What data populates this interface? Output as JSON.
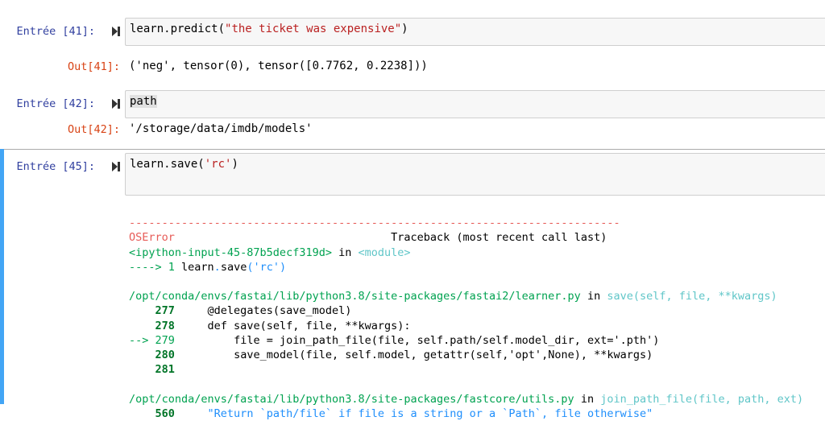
{
  "cells": [
    {
      "prompt": "Entrée [41]:",
      "code_plain": "learn.predict(",
      "code_string": "\"the ticket was expensive\"",
      "code_end": ")",
      "out_prompt": "Out[41]:",
      "output": "('neg', tensor(0), tensor([0.7762, 0.2238]))"
    },
    {
      "prompt": "Entrée [42]:",
      "code": "path",
      "out_prompt": "Out[42]:",
      "output": "'/storage/data/imdb/models'"
    },
    {
      "prompt": "Entrée [45]:",
      "code_plain": "learn.save(",
      "code_string": "'rc'",
      "code_end": ")"
    }
  ],
  "traceback": {
    "dashes": "---------------------------------------------------------------------------",
    "error_name": "OSError",
    "traceback_header": "Traceback (most recent call last)",
    "input_ref": "<ipython-input-45-87b5decf319d>",
    "in_word": " in ",
    "module": "<module>",
    "arrow_line_prefix": "----> 1 ",
    "arrow_line_obj": "learn",
    "arrow_line_dot": ".",
    "arrow_line_fn": "save",
    "arrow_line_p1": "(",
    "arrow_line_str": "'rc'",
    "arrow_line_p2": ")",
    "frame1": {
      "path": "/opt/conda/envs/fastai/lib/python3.8/site-packages/fastai2/learner.py",
      "func": "save(self, file, **kwargs)",
      "lines": [
        {
          "num": "277",
          "text": "@delegates(save_model)"
        },
        {
          "num": "278",
          "text": "def save(self, file, **kwargs):"
        },
        {
          "num": "279",
          "text": "file = join_path_file(file, self.path/self.model_dir, ext='.pth')",
          "current": true
        },
        {
          "num": "280",
          "text": "save_model(file, self.model, getattr(self,'opt',None), **kwargs)"
        },
        {
          "num": "281",
          "text": ""
        }
      ]
    },
    "frame2": {
      "path": "/opt/conda/envs/fastai/lib/python3.8/site-packages/fastcore/utils.py",
      "func": "join_path_file(file, path, ext)",
      "lines": [
        {
          "num": "560",
          "text": "\"Return `path/file` if file is a string or a `Path`, file otherwise\""
        }
      ]
    }
  }
}
